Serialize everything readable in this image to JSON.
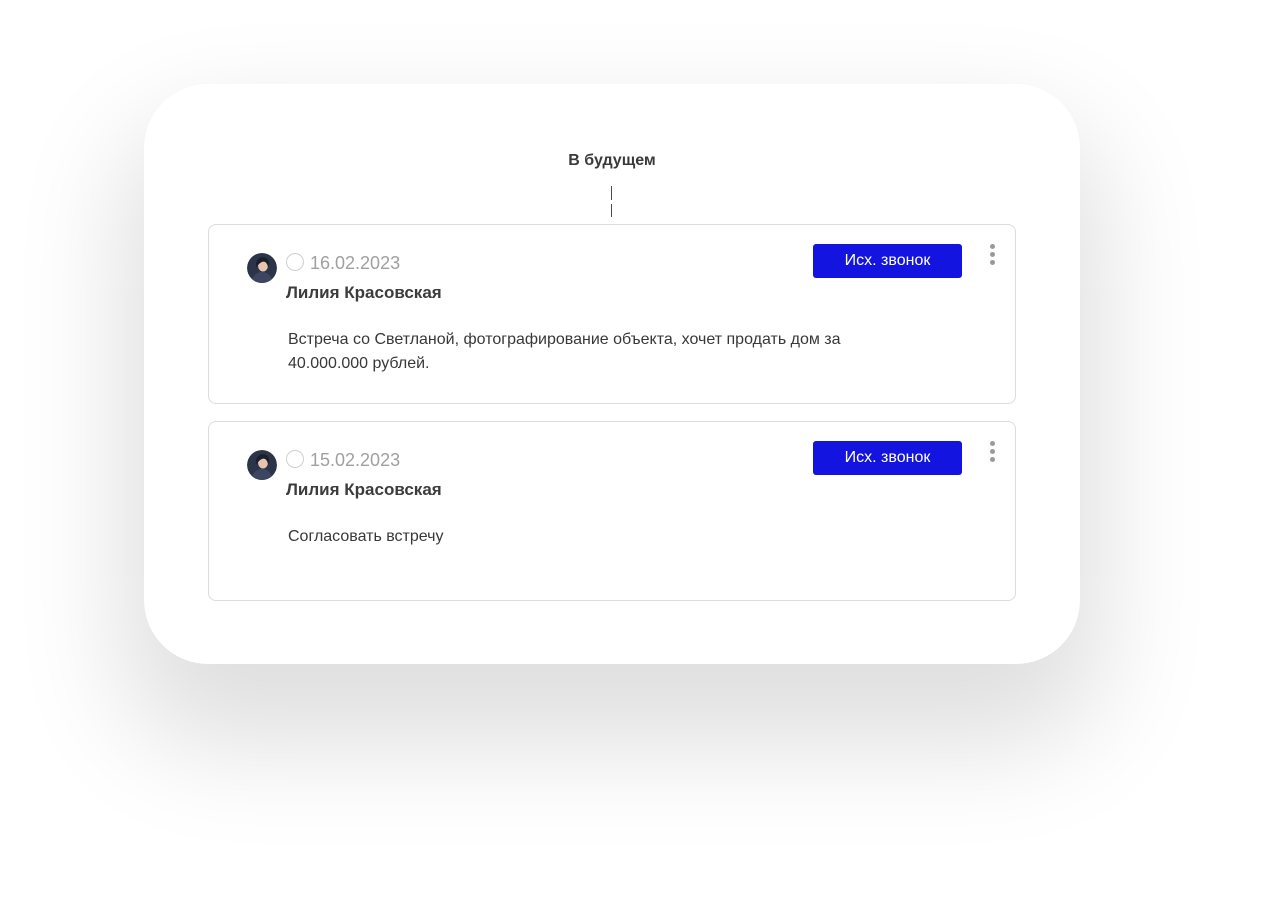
{
  "section": {
    "title": "В будущем"
  },
  "cards": [
    {
      "date": "16.02.2023",
      "author": "Лилия Красовская",
      "text": "Встреча со Светланой, фотографирование объекта, хочет продать дом за 40.000.000 рублей.",
      "button_label": "Исх. звонок",
      "avatar_icon": "user-avatar-icon",
      "status_icon": "empty-circle-icon",
      "menu_icon": "vertical-dots-icon"
    },
    {
      "date": "15.02.2023",
      "author": "Лилия Красовская",
      "text": "Согласовать встречу",
      "button_label": "Исх. звонок",
      "avatar_icon": "user-avatar-icon",
      "status_icon": "empty-circle-icon",
      "menu_icon": "vertical-dots-icon"
    }
  ],
  "colors": {
    "accent": "#1414e1",
    "muted_text": "#a0a0a0",
    "border": "#dcdcdc"
  }
}
